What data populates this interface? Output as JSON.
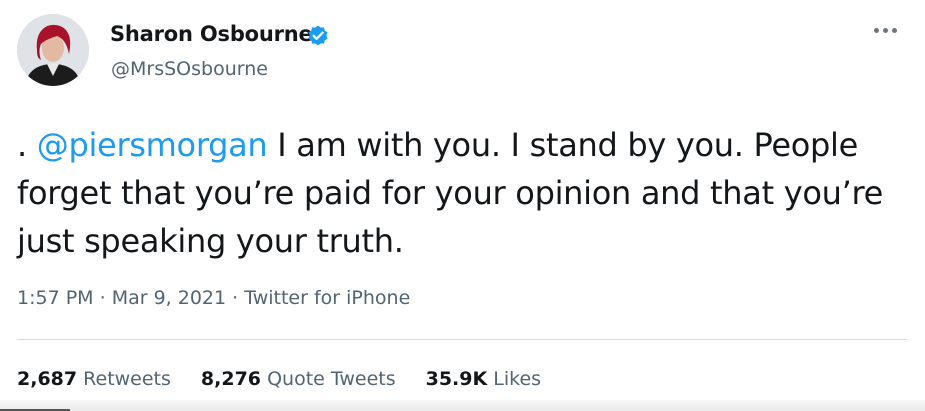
{
  "author": {
    "display_name": "Sharon Osbourne",
    "handle": "@MrsSOsbourne",
    "verified_icon": "verified-badge-icon"
  },
  "tweet": {
    "prefix": ". ",
    "mention": "@piersmorgan",
    "line1_rest": " I am with you. I stand by you.  People",
    "line2": "forget that you’re paid for your opinion and that you’re",
    "line3": "just speaking your truth."
  },
  "meta": {
    "time": "1:57 PM",
    "date": "Mar 9, 2021",
    "source": "Twitter for iPhone",
    "separator": " · "
  },
  "stats": {
    "retweets_count": "2,687",
    "retweets_label": "Retweets",
    "quotes_count": "8,276",
    "quotes_label": "Quote Tweets",
    "likes_count": "35.9K",
    "likes_label": "Likes"
  },
  "colors": {
    "link": "#1d9bf0",
    "secondary": "#536471",
    "text": "#14171a"
  }
}
